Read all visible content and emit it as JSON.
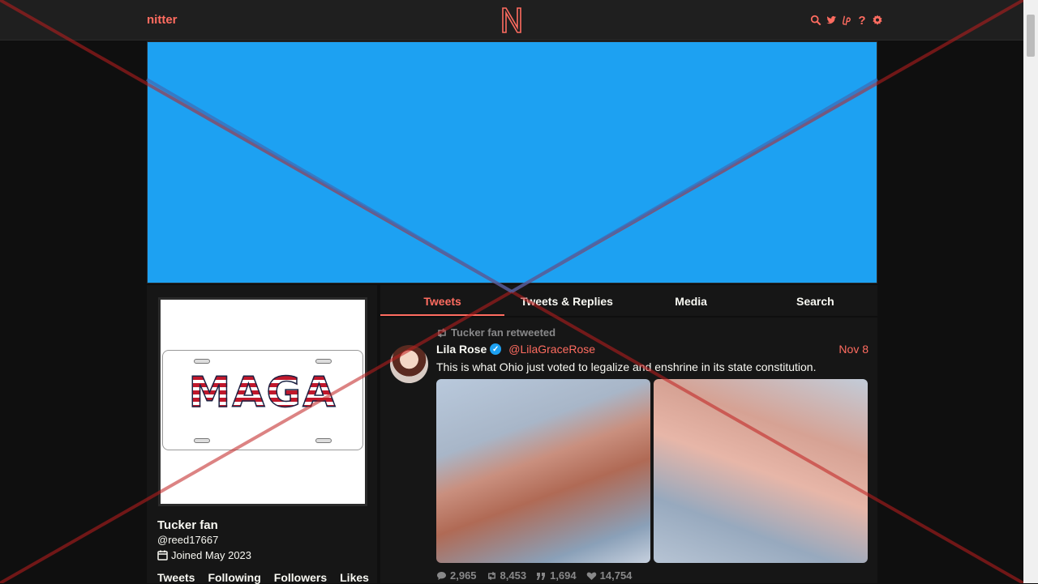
{
  "navbar": {
    "brand": "nitter",
    "icons": [
      "search-icon",
      "twitter-bird-icon",
      "liberapay-icon",
      "help-icon",
      "gear-icon"
    ]
  },
  "banner": {
    "color": "#1da1f2"
  },
  "profile": {
    "avatar_text": "MAGA",
    "fullname": "Tucker fan",
    "username": "@reed17667",
    "joined": "Joined May 2023",
    "stats": [
      "Tweets",
      "Following",
      "Followers",
      "Likes"
    ]
  },
  "tabs": [
    {
      "label": "Tweets",
      "active": true
    },
    {
      "label": "Tweets & Replies",
      "active": false
    },
    {
      "label": "Media",
      "active": false
    },
    {
      "label": "Search",
      "active": false
    }
  ],
  "tweet": {
    "retweet_header": "Tucker fan retweeted",
    "author_name": "Lila Rose",
    "author_handle": "@LilaGraceRose",
    "date": "Nov 8",
    "text": "This is what Ohio just voted to legalize and enshrine in its state constitution.",
    "stats": {
      "replies": "2,965",
      "retweets": "8,453",
      "quotes": "1,694",
      "likes": "14,754"
    }
  },
  "colors": {
    "accent": "#ff6c60",
    "background": "#0f0f0f",
    "panel": "#161616",
    "muted": "#888889",
    "overlay_red": "#c01e1e",
    "overlay_blue": "#3f6bb5"
  }
}
